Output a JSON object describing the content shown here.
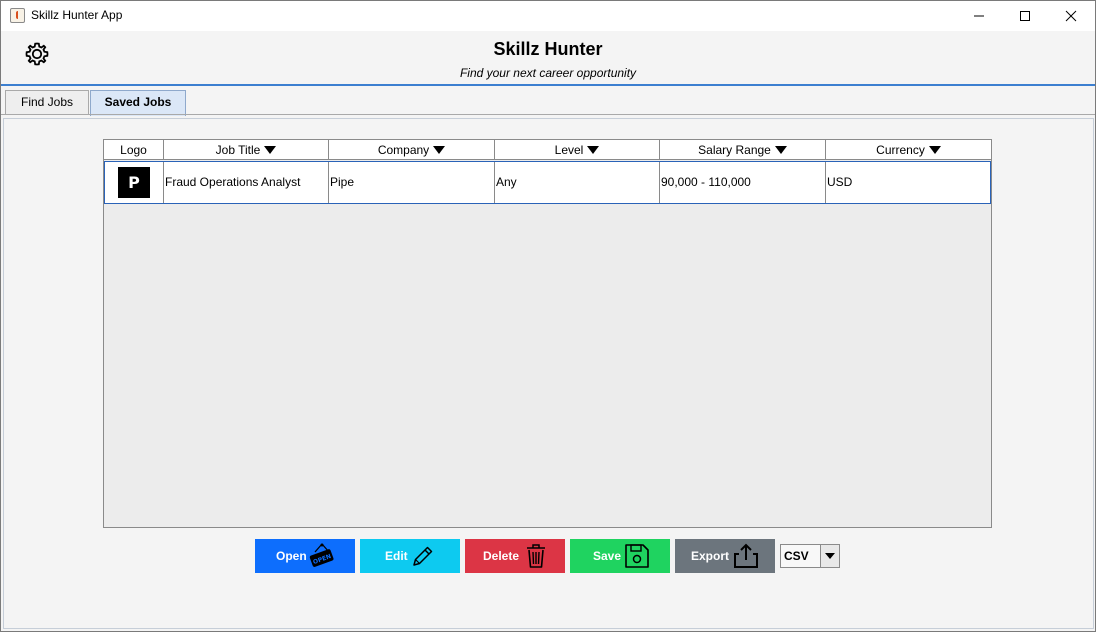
{
  "window": {
    "title": "Skillz Hunter App"
  },
  "header": {
    "title": "Skillz Hunter",
    "subtitle": "Find your next career opportunity"
  },
  "tabs": [
    {
      "label": "Find Jobs",
      "active": false
    },
    {
      "label": "Saved Jobs",
      "active": true
    }
  ],
  "table": {
    "columns": [
      "Logo",
      "Job Title",
      "Company",
      "Level",
      "Salary Range",
      "Currency"
    ],
    "rows": [
      {
        "logo": "P",
        "job_title": "Fraud Operations Analyst",
        "company": "Pipe",
        "level": "Any",
        "salary_range": "90,000 - 110,000",
        "currency": "USD"
      }
    ]
  },
  "actions": {
    "open": "Open",
    "edit": "Edit",
    "delete": "Delete",
    "save": "Save",
    "export": "Export",
    "export_format": "CSV",
    "open_sign_text": "OPEN"
  },
  "colors": {
    "open": "#0d6efd",
    "edit": "#0dcaf0",
    "delete": "#dc3545",
    "save": "#1fd360",
    "export": "#6c757d",
    "header_line": "#3c7fd0"
  },
  "icons": {
    "settings": "gear-icon",
    "open": "open-sign-icon",
    "edit": "pencil-icon",
    "delete": "trash-icon",
    "save": "floppy-disk-icon",
    "export": "share-upload-icon"
  }
}
